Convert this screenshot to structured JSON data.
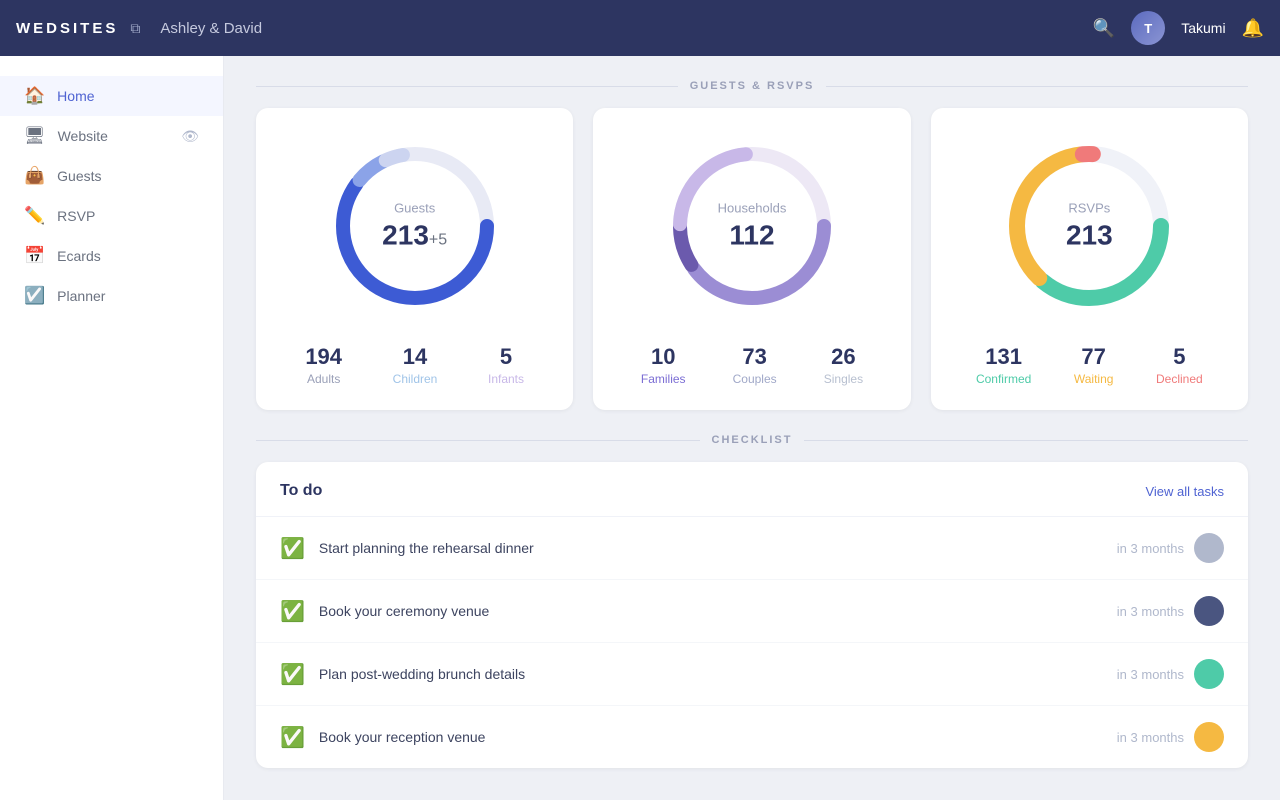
{
  "topnav": {
    "logo": "WEDSITES",
    "wedding_name": "Ashley & David",
    "username": "Takumi",
    "avatar_initials": "T"
  },
  "sidebar": {
    "items": [
      {
        "label": "Home",
        "icon": "🏠",
        "active": true
      },
      {
        "label": "Website",
        "icon": "🖥",
        "active": false,
        "has_eye": true
      },
      {
        "label": "Guests",
        "icon": "👜",
        "active": false
      },
      {
        "label": "RSVP",
        "icon": "✏️",
        "active": false
      },
      {
        "label": "Ecards",
        "icon": "📅",
        "active": false
      },
      {
        "label": "Planner",
        "icon": "☑️",
        "active": false
      }
    ]
  },
  "guests_rsvps": {
    "section_title": "GUESTS & RSVPS",
    "guests_card": {
      "title": "Guests",
      "total": "213",
      "delta": "+5",
      "stats": [
        {
          "number": "194",
          "label": "Adults",
          "class": "label-adults"
        },
        {
          "number": "14",
          "label": "Children",
          "class": "label-children"
        },
        {
          "number": "5",
          "label": "Infants",
          "class": "label-infants"
        }
      ]
    },
    "households_card": {
      "title": "Households",
      "total": "112",
      "stats": [
        {
          "number": "10",
          "label": "Families",
          "class": "label-families"
        },
        {
          "number": "73",
          "label": "Couples",
          "class": "label-couples"
        },
        {
          "number": "26",
          "label": "Singles",
          "class": "label-singles"
        }
      ]
    },
    "rsvps_card": {
      "title": "RSVPs",
      "total": "213",
      "stats": [
        {
          "number": "131",
          "label": "Confirmed",
          "class": "label-confirmed"
        },
        {
          "number": "77",
          "label": "Waiting",
          "class": "label-waiting"
        },
        {
          "number": "5",
          "label": "Declined",
          "class": "label-declined"
        }
      ]
    }
  },
  "checklist": {
    "section_title": "CHECKLIST",
    "header_title": "To do",
    "view_all_label": "View all tasks",
    "items": [
      {
        "text": "Start planning the rehearsal dinner",
        "due": "in 3 months",
        "avatar_bg": "#b0b8cc"
      },
      {
        "text": "Book your ceremony venue",
        "due": "in 3 months",
        "avatar_bg": "#6b7aaa"
      },
      {
        "text": "Plan post-wedding brunch details",
        "due": "in 3 months",
        "avatar_bg": "#4ecba8"
      },
      {
        "text": "Book your reception venue",
        "due": "in 3 months",
        "avatar_bg": "#f5b942"
      }
    ]
  }
}
